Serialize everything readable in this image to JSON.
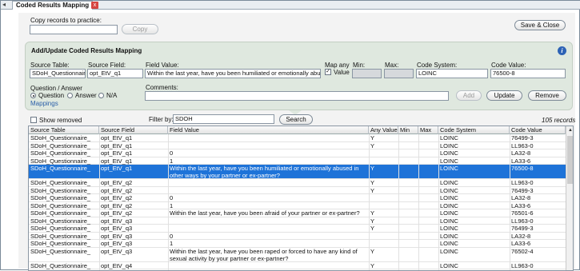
{
  "tab": {
    "title": "Coded Results Mapping",
    "close": "x"
  },
  "copy": {
    "label": "Copy records to practice:",
    "value": "",
    "button": "Copy"
  },
  "save_close": "Save & Close",
  "panel": {
    "title": "Add/Update Coded Results Mapping",
    "source_table_label": "Source Table:",
    "source_table": "SDoH_Questionnaire",
    "source_field_label": "Source Field:",
    "source_field": "opt_EtV_q1",
    "field_value_label": "Field Value:",
    "field_value": "Within the last year, have you been humiliated or emotionally abus",
    "map_any_label": "Map any",
    "map_any_value_label": "Value",
    "min_label": "Min:",
    "max_label": "Max:",
    "code_system_label": "Code System:",
    "code_system": "LOINC",
    "code_value_label": "Code Value:",
    "code_value": "76500-8",
    "qa_label": "Question / Answer",
    "question_label": "Question",
    "answer_label": "Answer",
    "na_label": "N/A",
    "mappings_link": "Mappings",
    "comments_label": "Comments:",
    "comments": "",
    "add": "Add",
    "update": "Update",
    "remove": "Remove"
  },
  "filter": {
    "show_removed": "Show removed",
    "filter_label": "Filter by:",
    "filter_value": "SDOH",
    "search": "Search",
    "records": "105 records"
  },
  "grid": {
    "columns": [
      "Source Table",
      "Source Field",
      "Field Value",
      "Any Value",
      "Min",
      "Max",
      "Code System",
      "Code Value"
    ],
    "rows": [
      {
        "t": "SDoH_Questionnaire_",
        "f": "opt_EtV_q1",
        "v": "",
        "a": "Y",
        "min": "",
        "max": "",
        "cs": "LOINC",
        "cv": "76499-3"
      },
      {
        "t": "SDoH_Questionnaire_",
        "f": "opt_EtV_q1",
        "v": "",
        "a": "Y",
        "min": "",
        "max": "",
        "cs": "LOINC",
        "cv": "LL963-0"
      },
      {
        "t": "SDoH_Questionnaire_",
        "f": "opt_EtV_q1",
        "v": "0",
        "a": "",
        "min": "",
        "max": "",
        "cs": "LOINC",
        "cv": "LA32-8"
      },
      {
        "t": "SDoH_Questionnaire_",
        "f": "opt_EtV_q1",
        "v": "1",
        "a": "",
        "min": "",
        "max": "",
        "cs": "LOINC",
        "cv": "LA33-6"
      },
      {
        "t": "SDoH_Questionnaire_",
        "f": "opt_EtV_q1",
        "v": "Within the last year, have you been humiliated or emotionally abused in other ways by your partner or ex-partner?",
        "a": "Y",
        "min": "",
        "max": "",
        "cs": "LOINC",
        "cv": "76500-8",
        "sel": true
      },
      {
        "t": "SDoH_Questionnaire_",
        "f": "opt_EtV_q2",
        "v": "",
        "a": "Y",
        "min": "",
        "max": "",
        "cs": "LOINC",
        "cv": "LL963-0"
      },
      {
        "t": "SDoH_Questionnaire_",
        "f": "opt_EtV_q2",
        "v": "",
        "a": "Y",
        "min": "",
        "max": "",
        "cs": "LOINC",
        "cv": "76499-3"
      },
      {
        "t": "SDoH_Questionnaire_",
        "f": "opt_EtV_q2",
        "v": "0",
        "a": "",
        "min": "",
        "max": "",
        "cs": "LOINC",
        "cv": "LA32-8"
      },
      {
        "t": "SDoH_Questionnaire_",
        "f": "opt_EtV_q2",
        "v": "1",
        "a": "",
        "min": "",
        "max": "",
        "cs": "LOINC",
        "cv": "LA33-6"
      },
      {
        "t": "SDoH_Questionnaire_",
        "f": "opt_EtV_q2",
        "v": "Within the last year, have you been afraid of your partner or ex-partner?",
        "a": "Y",
        "min": "",
        "max": "",
        "cs": "LOINC",
        "cv": "76501-6"
      },
      {
        "t": "SDoH_Questionnaire_",
        "f": "opt_EtV_q3",
        "v": "",
        "a": "Y",
        "min": "",
        "max": "",
        "cs": "LOINC",
        "cv": "LL963-0"
      },
      {
        "t": "SDoH_Questionnaire_",
        "f": "opt_EtV_q3",
        "v": "",
        "a": "Y",
        "min": "",
        "max": "",
        "cs": "LOINC",
        "cv": "76499-3"
      },
      {
        "t": "SDoH_Questionnaire_",
        "f": "opt_EtV_q3",
        "v": "0",
        "a": "",
        "min": "",
        "max": "",
        "cs": "LOINC",
        "cv": "LA32-8"
      },
      {
        "t": "SDoH_Questionnaire_",
        "f": "opt_EtV_q3",
        "v": "1",
        "a": "",
        "min": "",
        "max": "",
        "cs": "LOINC",
        "cv": "LA33-6"
      },
      {
        "t": "SDoH_Questionnaire_",
        "f": "opt_EtV_q3",
        "v": "Within the last year, have you been raped or forced to have any kind of sexual activity by your partner or ex-partner?",
        "a": "Y",
        "min": "",
        "max": "",
        "cs": "LOINC",
        "cv": "76502-4"
      },
      {
        "t": "SDoH_Questionnaire_",
        "f": "opt_EtV_q4",
        "v": "",
        "a": "Y",
        "min": "",
        "max": "",
        "cs": "LOINC",
        "cv": "LL963-0"
      }
    ]
  },
  "colors": {
    "selection": "#1e73d8",
    "panel": "#dfe8df",
    "link": "#2b5fa8",
    "info": "#2d62b5"
  }
}
